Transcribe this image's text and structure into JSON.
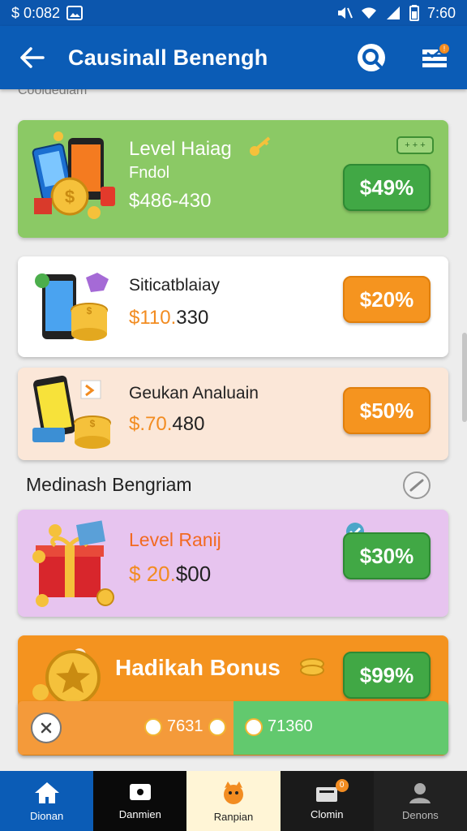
{
  "status_bar": {
    "left_text": "$ 0:082",
    "time": "7:60"
  },
  "app_bar": {
    "title": "Causinall Benengh"
  },
  "partial_header": "Cooldedlam",
  "cards": [
    {
      "title": "Level Haiag",
      "subtitle": "Fndol",
      "range": "$486-430",
      "tag": "+ + +",
      "pill": "$49%"
    },
    {
      "title": "Siticatblaiay",
      "range_prefix": "$",
      "range_accent": "110.",
      "range_rest": "330",
      "pill": "$20%"
    },
    {
      "title": "Geukan Analuain",
      "range_prefix": "$",
      "range_accent": ".70.",
      "range_rest": "480",
      "pill": "$50%"
    },
    {
      "title": "Level Ranij",
      "range_prefix": "$ ",
      "range_accent": "20.",
      "range_rest": "$00",
      "pill": "$30%"
    },
    {
      "title": "Hadikah Bonus",
      "pill": "$99%"
    }
  ],
  "section": {
    "title": "Medinash Bengriam"
  },
  "overlay": {
    "left_amount": "7631",
    "right_amount": "71360"
  },
  "bottom_nav": [
    {
      "label": "Dionan"
    },
    {
      "label": "Danmien"
    },
    {
      "label": "Ranpian"
    },
    {
      "label": "Clomin",
      "badge": "0"
    },
    {
      "label": "Denons"
    }
  ],
  "colors": {
    "primary": "#0b5cb6",
    "green_card": "#8bc965",
    "orange_card": "#f4931f",
    "pink_card": "#e7c4ef",
    "peach_card": "#fbe7d8",
    "accent_orange": "#f28c21",
    "green_pill": "#41a845"
  }
}
